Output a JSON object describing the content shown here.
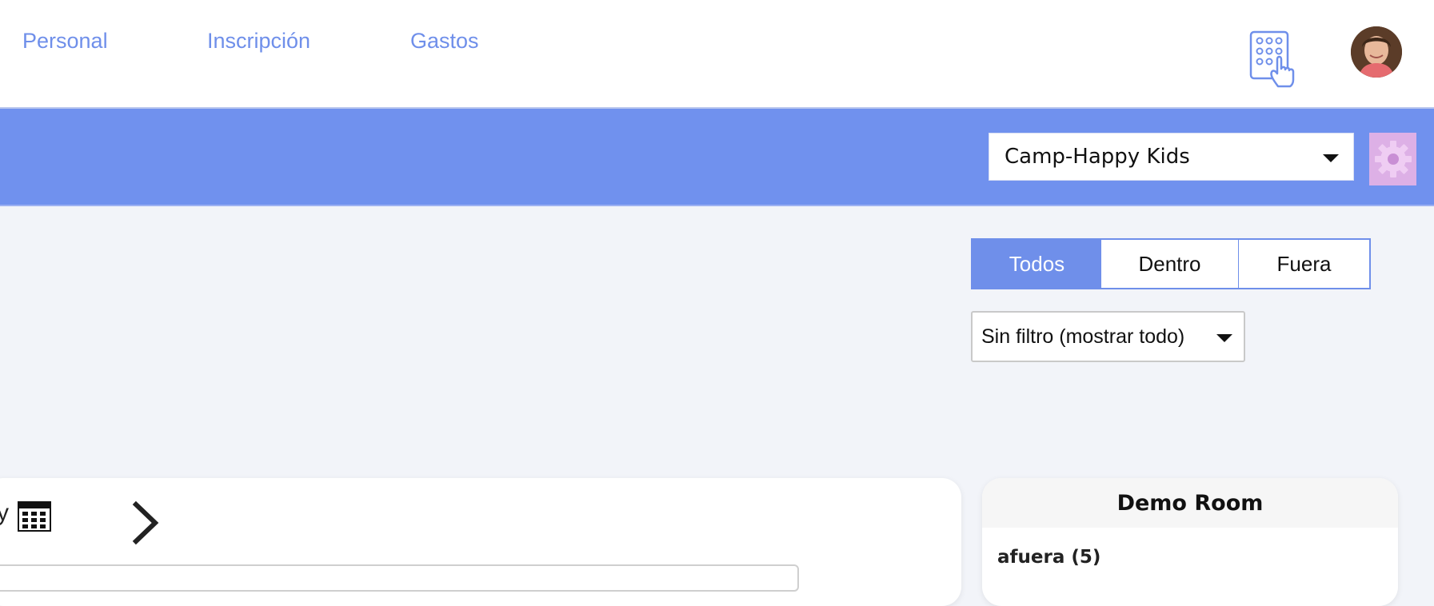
{
  "nav": {
    "links": [
      "Personal",
      "Inscripción",
      "Gastos"
    ]
  },
  "icons": {
    "keypad": "keypad-touch-icon",
    "avatar": "user-avatar",
    "settings": "gear-icon",
    "calendar": "calendar-icon",
    "next": "chevron-right-icon"
  },
  "school_select": {
    "value": "Camp-Happy Kids"
  },
  "segments": {
    "all": "Todos",
    "inside": "Dentro",
    "outside": "Fuera",
    "active": "Todos"
  },
  "filter_select": {
    "value": "Sin filtro (mostrar todo)"
  },
  "date_nav": {
    "partial_text": "y"
  },
  "room_card": {
    "title": "Demo Room",
    "subtitle": "afuera (5)"
  },
  "colors": {
    "accent": "#7091ee",
    "link": "#6f8fea",
    "gear_bg": "#ddb0e6",
    "page_bg": "#f2f4f9"
  }
}
